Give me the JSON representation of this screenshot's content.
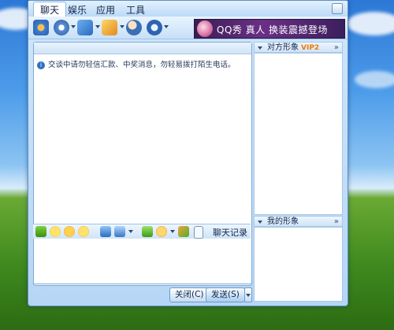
{
  "window": {
    "menu": [
      {
        "label": "聊天",
        "active": true
      },
      {
        "label": "娱乐",
        "active": false
      },
      {
        "label": "应用",
        "active": false
      },
      {
        "label": "工具",
        "active": false
      }
    ],
    "toolbar_icons": [
      "webcam-icon",
      "video-call-icon",
      "voice-icon",
      "file-transfer-icon",
      "add-friend-icon",
      "remote-assist-icon"
    ],
    "banner": {
      "text": "QQ秀 真人 换装震撼登场"
    },
    "chat": {
      "notice": "交谈中请勿轻信汇款、中奖消息，勿轻易拨打陌生电话。"
    },
    "format_toolbar": {
      "icons": [
        "font-icon",
        "emoticon-icon",
        "magic-emoticon-icon",
        "shake-icon",
        "screenshot-icon",
        "image-icon",
        "music-icon",
        "scene-icon",
        "doodle-icon"
      ],
      "history_label": "聊天记录"
    },
    "buttons": {
      "close": "关闭(C)",
      "send": "发送(S)"
    },
    "side": {
      "peer_title": "对方形象",
      "peer_badge": "VIP2",
      "peer_chevron": "»",
      "mine_title": "我的形象",
      "mine_chevron": "»"
    },
    "colors": {
      "accent": "#4d9cea",
      "banner_bg": "#6a2f86",
      "vip": "#f07a00"
    }
  }
}
